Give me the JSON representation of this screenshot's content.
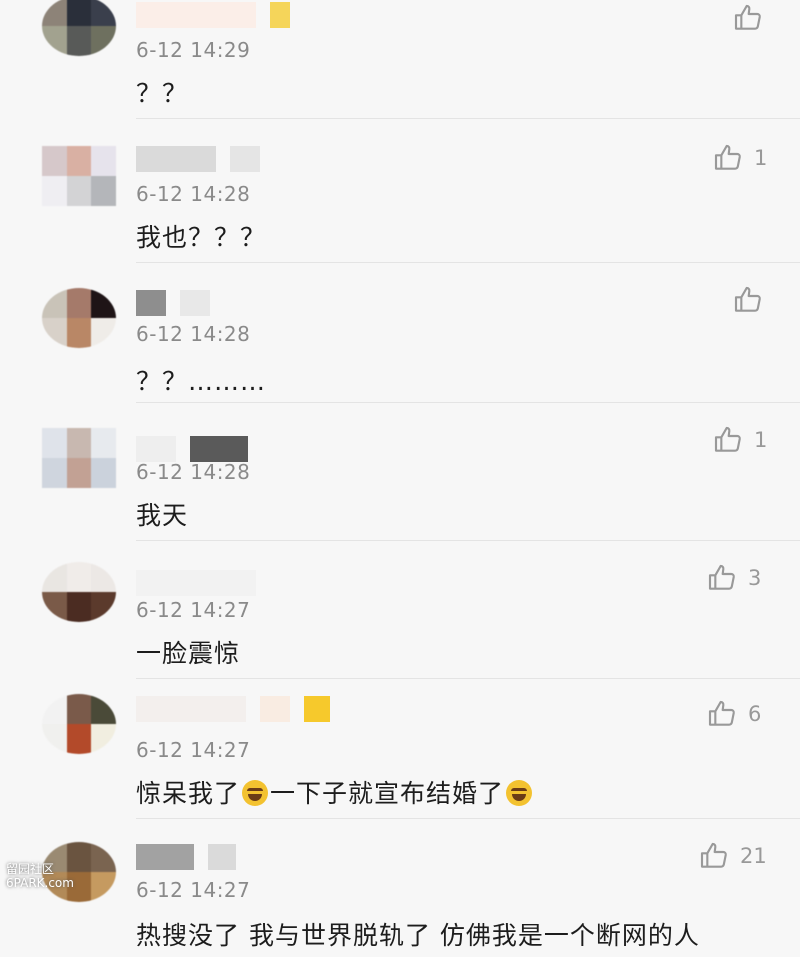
{
  "comments": [
    {
      "time": "6-12 14:29",
      "text": "？？",
      "likes": ""
    },
    {
      "time": "6-12 14:28",
      "text": "我也？？？",
      "likes": "1"
    },
    {
      "time": "6-12 14:28",
      "text": "？？………",
      "likes": ""
    },
    {
      "time": "6-12 14:28",
      "text": "我天",
      "likes": "1"
    },
    {
      "time": "6-12 14:27",
      "text": "一脸震惊",
      "likes": "3"
    },
    {
      "time": "6-12 14:27",
      "text_part1": "惊呆我了",
      "text_part2": "一下子就宣布结婚了",
      "likes": "6"
    },
    {
      "time": "6-12 14:27",
      "text": "热搜没了 我与世界脱轨了 仿佛我是一个断网的人",
      "likes": "21"
    }
  ],
  "watermark": {
    "line1": "留园社区",
    "line2": "6PARK.com"
  },
  "colors": {
    "background": "#f7f7f7",
    "text": "#1d1d1d",
    "meta": "#8a8a8a",
    "like": "#999999"
  },
  "icons": {
    "like": "thumbs-up-icon",
    "emoji": "laugh-cry-emoji-icon"
  }
}
